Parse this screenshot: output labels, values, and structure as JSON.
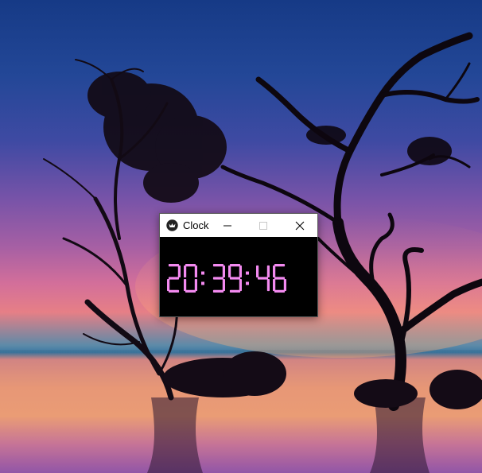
{
  "window": {
    "title": "Clock",
    "icon": "feather-app-icon",
    "controls": {
      "minimize_icon": "minimize-icon",
      "maximize_icon": "maximize-icon",
      "close_icon": "close-icon"
    }
  },
  "clock": {
    "time": "20:39:46",
    "digit_color": "#f38af0"
  },
  "colors": {
    "titlebar_bg": "#ffffff",
    "window_bg": "#000000"
  }
}
